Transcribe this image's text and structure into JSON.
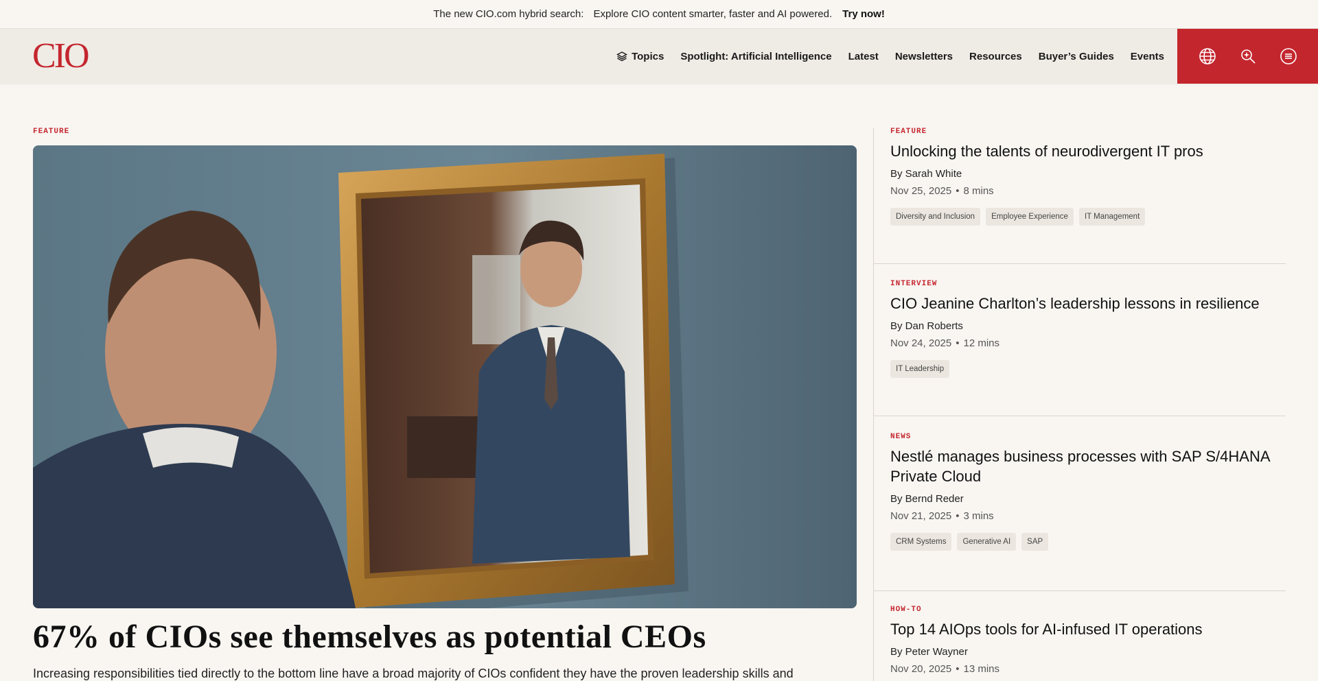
{
  "promo": {
    "label": "The new CIO.com hybrid search:",
    "message": "Explore CIO content smarter, faster and AI powered.",
    "cta": "Try now!"
  },
  "header": {
    "logo": "CIO",
    "nav": [
      "Topics",
      "Spotlight: Artificial Intelligence",
      "Latest",
      "Newsletters",
      "Resources",
      "Buyer’s Guides",
      "Events"
    ],
    "icons": [
      "globe-icon",
      "search-ai-icon",
      "menu-icon"
    ]
  },
  "colors": {
    "brand": "#c4262e",
    "background": "#f9f6f2",
    "header": "#efebe5"
  },
  "feature": {
    "kicker": "FEATURE",
    "headline": "67% of CIOs see themselves as potential CEOs",
    "deck": "Increasing responsibilities tied directly to the bottom line have a broad majority of CIOs confident they have the proven leadership skills and"
  },
  "stories": [
    {
      "kicker": "FEATURE",
      "title": "Unlocking the talents of neurodivergent IT pros",
      "byline": "By Sarah White",
      "date": "Nov 25, 2025",
      "read_time": "8 mins",
      "tags": [
        "Diversity and Inclusion",
        "Employee Experience",
        "IT Management"
      ]
    },
    {
      "kicker": "INTERVIEW",
      "title": "CIO Jeanine Charlton’s leadership lessons in resilience",
      "byline": "By Dan Roberts",
      "date": "Nov 24, 2025",
      "read_time": "12 mins",
      "tags": [
        "IT Leadership"
      ]
    },
    {
      "kicker": "NEWS",
      "title": "Nestlé manages business processes with SAP S/4HANA Private Cloud",
      "byline": "By Bernd Reder",
      "date": "Nov 21, 2025",
      "read_time": "3 mins",
      "tags": [
        "CRM Systems",
        "Generative AI",
        "SAP"
      ]
    },
    {
      "kicker": "HOW-TO",
      "title": "Top 14 AIOps tools for AI-infused IT operations",
      "byline": "By Peter Wayner",
      "date": "Nov 20, 2025",
      "read_time": "13 mins",
      "tags": []
    }
  ]
}
